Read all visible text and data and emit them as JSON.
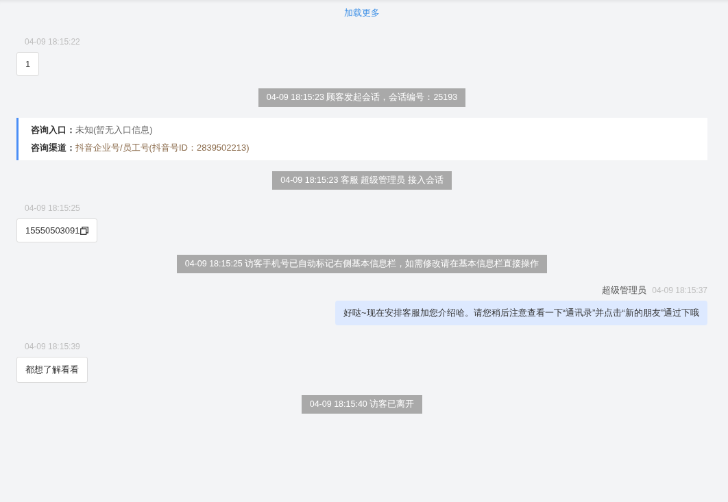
{
  "load_more": "加载更多",
  "messages": [
    {
      "kind": "visitor",
      "time": "04-09 18:15:22",
      "text": "1",
      "copyable": false
    },
    {
      "kind": "system",
      "text": "04-09 18:15:23 顾客发起会话，会话编号：25193"
    },
    {
      "kind": "info",
      "rows": [
        {
          "label": "咨询入口：",
          "value": "未知(暂无入口信息)",
          "color": "#666666"
        },
        {
          "label": "咨询渠道：",
          "value": "抖音企业号/员工号(抖音号ID：2839502213)",
          "color": "#8a6a4a"
        }
      ]
    },
    {
      "kind": "system",
      "text": "04-09 18:15:23 客服 超级管理员 接入会话"
    },
    {
      "kind": "visitor",
      "time": "04-09 18:15:25",
      "text": "15550503091",
      "copyable": true
    },
    {
      "kind": "system",
      "text": "04-09 18:15:25 访客手机号已自动标记右侧基本信息栏，如需修改请在基本信息栏直接操作"
    },
    {
      "kind": "agent",
      "name": "超级管理员",
      "time": "04-09 18:15:37",
      "text": "好哒~现在安排客服加您介绍哈。请您稍后注意查看一下“通讯录”并点击“新的朋友”通过下哦"
    },
    {
      "kind": "visitor",
      "time": "04-09 18:15:39",
      "text": "都想了解看看",
      "copyable": false
    },
    {
      "kind": "system",
      "text": "04-09 18:15:40 访客已离开"
    }
  ]
}
